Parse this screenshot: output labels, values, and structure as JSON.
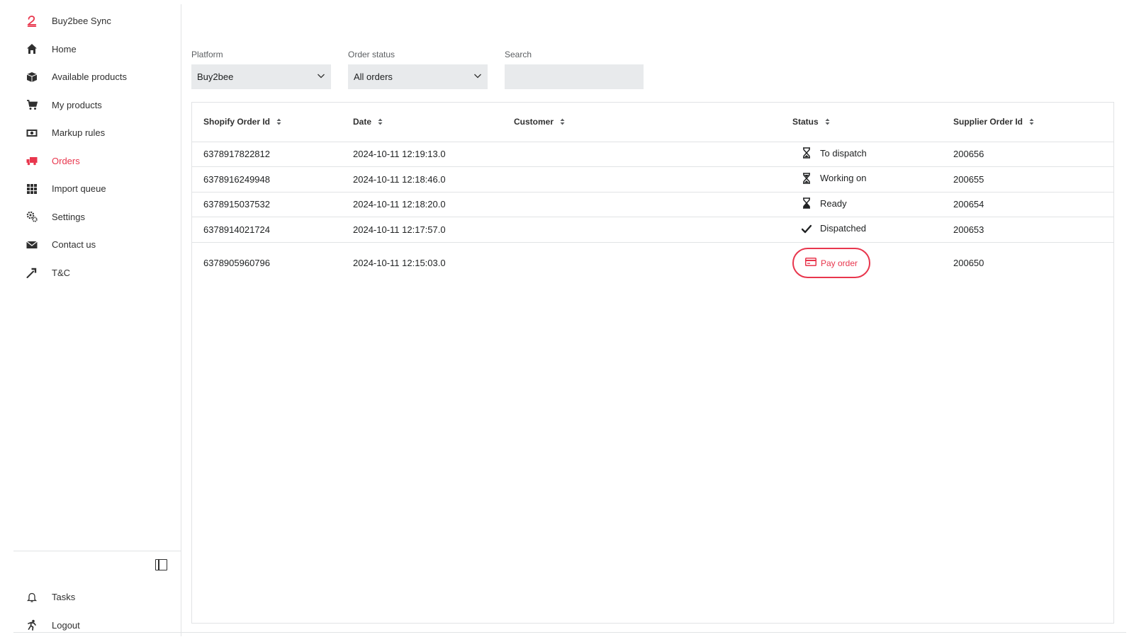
{
  "sidebar": {
    "brand": "Buy2bee Sync",
    "items": [
      {
        "label": "Home",
        "icon": "home-icon"
      },
      {
        "label": "Available products",
        "icon": "box-icon"
      },
      {
        "label": "My products",
        "icon": "cart-icon"
      },
      {
        "label": "Markup rules",
        "icon": "money-icon"
      },
      {
        "label": "Orders",
        "icon": "truck-icon",
        "active": true
      },
      {
        "label": "Import queue",
        "icon": "grid-icon"
      },
      {
        "label": "Settings",
        "icon": "gears-icon"
      },
      {
        "label": "Contact us",
        "icon": "envelope-icon"
      },
      {
        "label": "T&C",
        "icon": "gavel-icon"
      }
    ],
    "bottom_items": [
      {
        "label": "Tasks",
        "icon": "bell-icon"
      },
      {
        "label": "Logout",
        "icon": "running-person-icon"
      }
    ]
  },
  "filters": {
    "platform": {
      "label": "Platform",
      "value": "Buy2bee"
    },
    "order_status": {
      "label": "Order status",
      "value": "All orders"
    },
    "search": {
      "label": "Search",
      "value": "",
      "placeholder": ""
    }
  },
  "table": {
    "columns": [
      "Shopify Order Id",
      "Date",
      "Customer",
      "Status",
      "Supplier Order Id"
    ],
    "rows": [
      {
        "shopify_id": "6378917822812",
        "date": "2024-10-11 12:19:13.0",
        "customer": "",
        "status": "To dispatch",
        "status_icon": "hourglass-icon",
        "supplier_id": "200656"
      },
      {
        "shopify_id": "6378916249948",
        "date": "2024-10-11 12:18:46.0",
        "customer": "",
        "status": "Working on",
        "status_icon": "hourglass-icon",
        "supplier_id": "200655"
      },
      {
        "shopify_id": "6378915037532",
        "date": "2024-10-11 12:18:20.0",
        "customer": "",
        "status": "Ready",
        "status_icon": "hourglass-icon",
        "supplier_id": "200654"
      },
      {
        "shopify_id": "6378914021724",
        "date": "2024-10-11 12:17:57.0",
        "customer": "",
        "status": "Dispatched",
        "status_icon": "check-icon",
        "supplier_id": "200653"
      },
      {
        "shopify_id": "6378905960796",
        "date": "2024-10-11 12:15:03.0",
        "customer": "",
        "status": "Pay order",
        "status_icon": "credit-card-icon",
        "supplier_id": "200650"
      }
    ]
  },
  "colors": {
    "accent": "#e8364d",
    "input_bg": "#e8eaec",
    "border": "#e1e3e5"
  }
}
